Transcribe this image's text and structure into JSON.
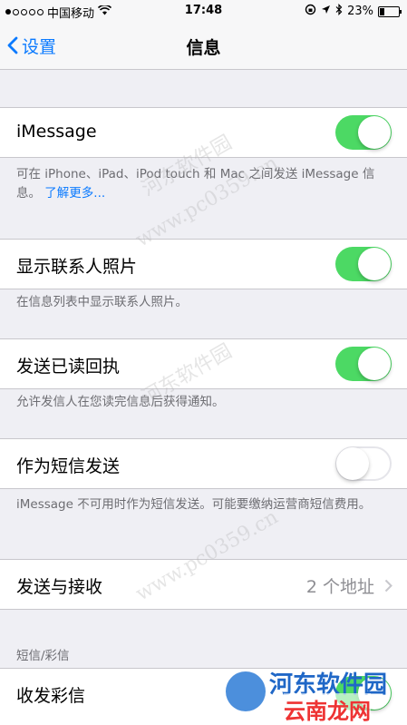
{
  "status_bar": {
    "carrier": "中国移动",
    "time": "17:48",
    "battery": "23%"
  },
  "nav": {
    "back_label": "设置",
    "title": "信息"
  },
  "sections": {
    "imessage": {
      "label": "iMessage",
      "toggle_on": true,
      "footer_text": "可在 iPhone、iPad、iPod touch 和 Mac 之间发送 iMessage 信息。",
      "footer_link": "了解更多..."
    },
    "contact_photos": {
      "label": "显示联系人照片",
      "toggle_on": true,
      "footer_text": "在信息列表中显示联系人照片。"
    },
    "read_receipts": {
      "label": "发送已读回执",
      "toggle_on": true,
      "footer_text": "允许发信人在您读完信息后获得通知。"
    },
    "send_as_sms": {
      "label": "作为短信发送",
      "toggle_on": false,
      "footer_text": "iMessage 不可用时作为短信发送。可能要缴纳运营商短信费用。"
    },
    "send_receive": {
      "label": "发送与接收",
      "value": "2 个地址"
    },
    "sms_mms": {
      "header": "短信/彩信",
      "mms_label": "收发彩信",
      "mms_toggle_on": true
    }
  },
  "watermark": {
    "site": "www.pc0359.cn",
    "name": "河东软件园",
    "logo_brand": "河东软件园",
    "logo_sub": "云南龙网"
  },
  "colors": {
    "accent": "#0a7aff",
    "toggle_on": "#4cd964",
    "background": "#efeff4"
  }
}
